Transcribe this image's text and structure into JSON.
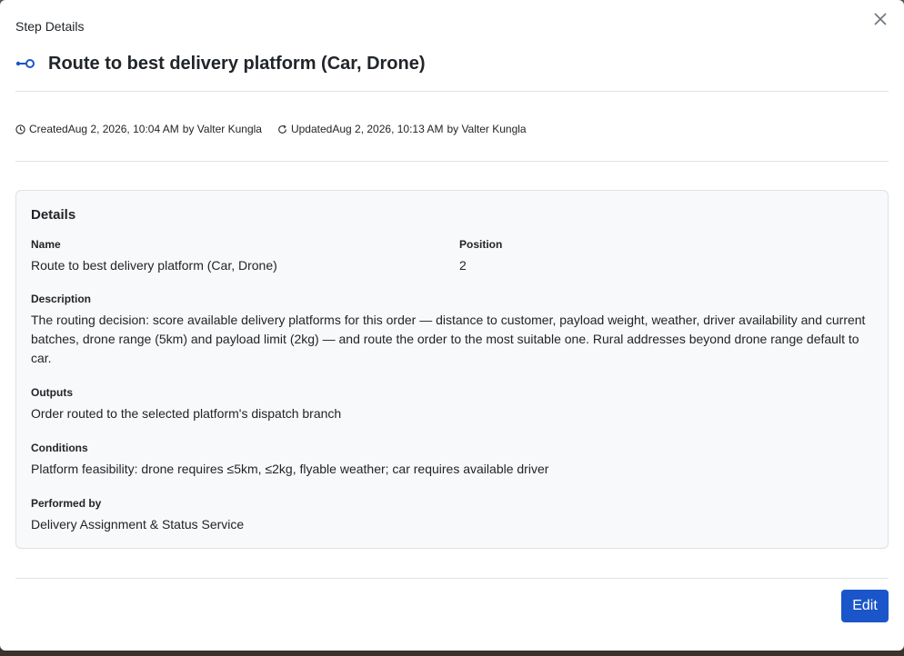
{
  "header": {
    "kicker": "Step Details",
    "title": "Route to best delivery platform (Car, Drone)",
    "icon": "route-icon"
  },
  "meta": {
    "created_label": "Created",
    "created_at": "Aug 2, 2026, 10:04 AM",
    "created_by": "by Valter Kungla",
    "updated_label": "Updated",
    "updated_at": "Aug 2, 2026, 10:13 AM",
    "updated_by": "by Valter Kungla"
  },
  "details": {
    "heading": "Details",
    "name_label": "Name",
    "name_value": "Route to best delivery platform (Car, Drone)",
    "position_label": "Position",
    "position_value": "2",
    "description_label": "Description",
    "description_value": "The routing decision: score available delivery platforms for this order — distance to customer, payload weight, weather, driver availability and current batches, drone range (5km) and payload limit (2kg) — and route the order to the most suitable one. Rural addresses beyond drone range default to car.",
    "outputs_label": "Outputs",
    "outputs_value": "Order routed to the selected platform's dispatch branch",
    "conditions_label": "Conditions",
    "conditions_value": "Platform feasibility: drone requires ≤5km, ≤2kg, flyable weather; car requires available driver",
    "performed_label": "Performed by",
    "performed_value": "Delivery Assignment & Status Service"
  },
  "footer": {
    "edit_label": "Edit"
  },
  "colors": {
    "accent": "#1a56c9",
    "card_bg": "#f8f9fa",
    "border": "#dee2e6"
  }
}
